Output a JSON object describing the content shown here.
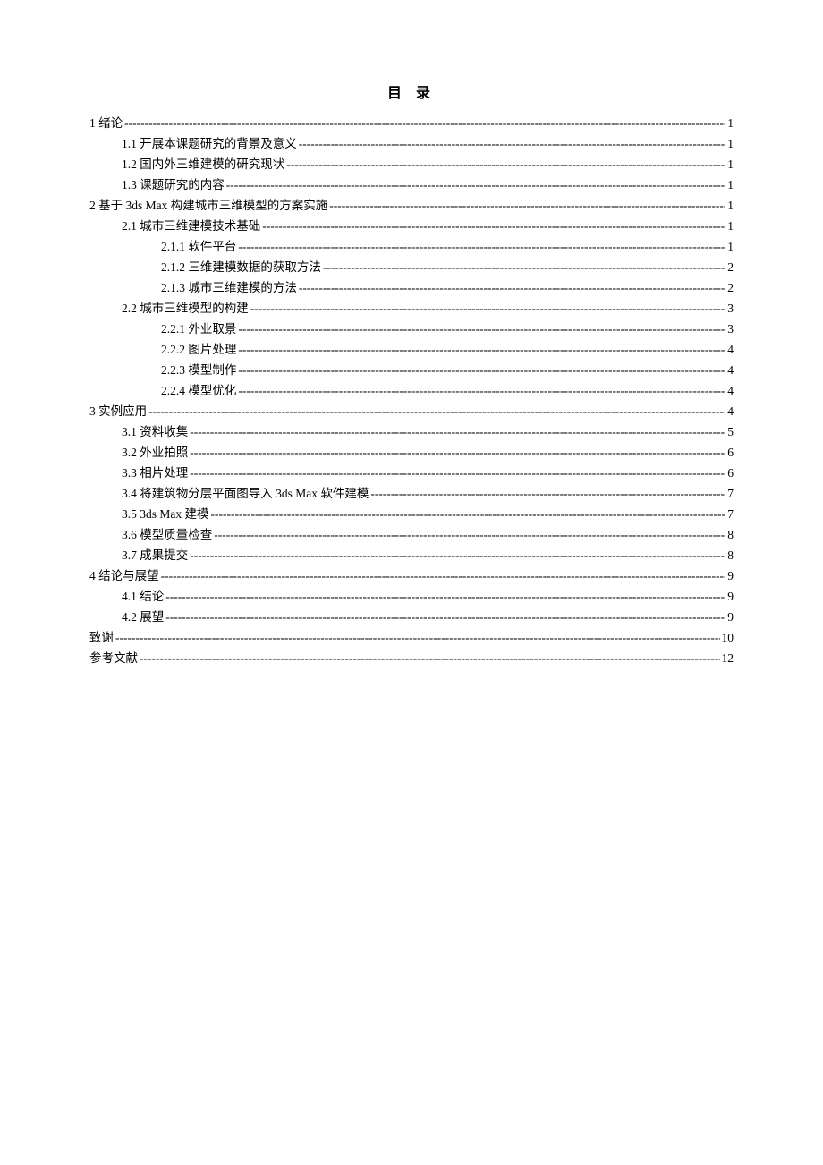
{
  "title": "目 录",
  "entries": [
    {
      "level": 0,
      "bold": false,
      "label": "1 绪论",
      "page": "1"
    },
    {
      "level": 1,
      "bold": false,
      "label": "1.1 开展本课题研究的背景及意义",
      "page": "1"
    },
    {
      "level": 1,
      "bold": false,
      "label": "1.2 国内外三维建模的研究现状",
      "page": "1"
    },
    {
      "level": 1,
      "bold": false,
      "label": "1.3 课题研究的内容",
      "page": "1"
    },
    {
      "level": 0,
      "bold": false,
      "label": "2 基于 3ds Max 构建城市三维模型的方案实施 ",
      "page": "1"
    },
    {
      "level": 1,
      "bold": false,
      "label": "2.1 城市三维建模技术基础",
      "page": "1"
    },
    {
      "level": 2,
      "bold": false,
      "label": "2.1.1 软件平台",
      "page": "1"
    },
    {
      "level": 2,
      "bold": false,
      "label": "2.1.2 三维建模数据的获取方法",
      "page": "2"
    },
    {
      "level": 2,
      "bold": false,
      "label": "2.1.3 城市三维建模的方法",
      "page": "2"
    },
    {
      "level": 1,
      "bold": false,
      "label": "2.2 城市三维模型的构建",
      "page": "3"
    },
    {
      "level": 2,
      "bold": false,
      "label": "2.2.1 外业取景",
      "page": "3"
    },
    {
      "level": 2,
      "bold": false,
      "label": "2.2.2 图片处理",
      "page": "4"
    },
    {
      "level": 2,
      "bold": false,
      "label": "2.2.3 模型制作",
      "page": "4"
    },
    {
      "level": 2,
      "bold": false,
      "label": "2.2.4 模型优化",
      "page": "4"
    },
    {
      "level": 0,
      "bold": false,
      "label": "3 实例应用 ",
      "page": "4"
    },
    {
      "level": 1,
      "bold": false,
      "label": "3.1 资料收集",
      "page": "5"
    },
    {
      "level": 1,
      "bold": false,
      "label": "3.2 外业拍照",
      "page": "6"
    },
    {
      "level": 1,
      "bold": false,
      "label": "3.3 相片处理",
      "page": "6"
    },
    {
      "level": 1,
      "bold": false,
      "label": "3.4 将建筑物分层平面图导入 3ds Max 软件建模",
      "page": "7"
    },
    {
      "level": 1,
      "bold": false,
      "label": "3.5 3ds Max 建模 ",
      "page": "7"
    },
    {
      "level": 1,
      "bold": false,
      "label": "3.6 模型质量检查",
      "page": "8"
    },
    {
      "level": 1,
      "bold": false,
      "label": "3.7 成果提交",
      "page": "8"
    },
    {
      "level": 0,
      "bold": false,
      "label": "4 结论与展望",
      "page": "9"
    },
    {
      "level": 1,
      "bold": false,
      "label": "4.1 结论",
      "page": "9"
    },
    {
      "level": 1,
      "bold": false,
      "label": "4.2 展望",
      "page": "9"
    },
    {
      "level": 0,
      "bold": false,
      "label": "致谢",
      "page": "10"
    },
    {
      "level": 0,
      "bold": false,
      "label": "参考文献",
      "page": "12"
    }
  ]
}
